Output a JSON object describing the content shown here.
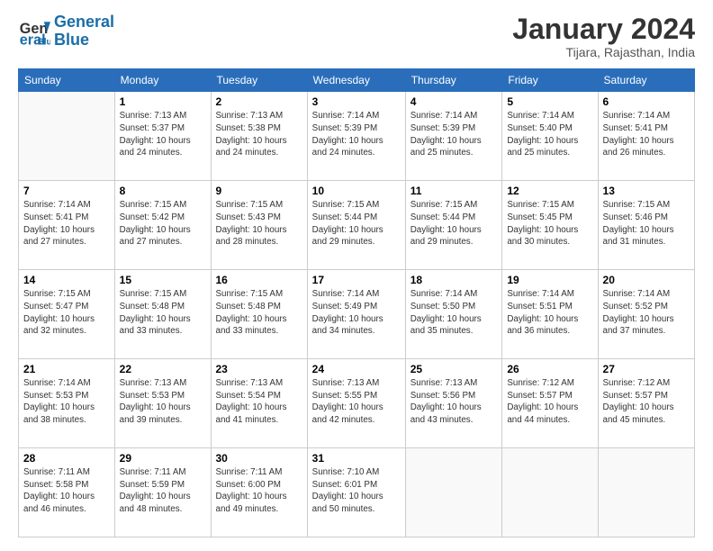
{
  "header": {
    "logo_line1": "General",
    "logo_line2": "Blue",
    "title": "January 2024",
    "location": "Tijara, Rajasthan, India"
  },
  "days_of_week": [
    "Sunday",
    "Monday",
    "Tuesday",
    "Wednesday",
    "Thursday",
    "Friday",
    "Saturday"
  ],
  "weeks": [
    [
      {
        "day": "",
        "info": ""
      },
      {
        "day": "1",
        "info": "Sunrise: 7:13 AM\nSunset: 5:37 PM\nDaylight: 10 hours\nand 24 minutes."
      },
      {
        "day": "2",
        "info": "Sunrise: 7:13 AM\nSunset: 5:38 PM\nDaylight: 10 hours\nand 24 minutes."
      },
      {
        "day": "3",
        "info": "Sunrise: 7:14 AM\nSunset: 5:39 PM\nDaylight: 10 hours\nand 24 minutes."
      },
      {
        "day": "4",
        "info": "Sunrise: 7:14 AM\nSunset: 5:39 PM\nDaylight: 10 hours\nand 25 minutes."
      },
      {
        "day": "5",
        "info": "Sunrise: 7:14 AM\nSunset: 5:40 PM\nDaylight: 10 hours\nand 25 minutes."
      },
      {
        "day": "6",
        "info": "Sunrise: 7:14 AM\nSunset: 5:41 PM\nDaylight: 10 hours\nand 26 minutes."
      }
    ],
    [
      {
        "day": "7",
        "info": "Sunrise: 7:14 AM\nSunset: 5:41 PM\nDaylight: 10 hours\nand 27 minutes."
      },
      {
        "day": "8",
        "info": "Sunrise: 7:15 AM\nSunset: 5:42 PM\nDaylight: 10 hours\nand 27 minutes."
      },
      {
        "day": "9",
        "info": "Sunrise: 7:15 AM\nSunset: 5:43 PM\nDaylight: 10 hours\nand 28 minutes."
      },
      {
        "day": "10",
        "info": "Sunrise: 7:15 AM\nSunset: 5:44 PM\nDaylight: 10 hours\nand 29 minutes."
      },
      {
        "day": "11",
        "info": "Sunrise: 7:15 AM\nSunset: 5:44 PM\nDaylight: 10 hours\nand 29 minutes."
      },
      {
        "day": "12",
        "info": "Sunrise: 7:15 AM\nSunset: 5:45 PM\nDaylight: 10 hours\nand 30 minutes."
      },
      {
        "day": "13",
        "info": "Sunrise: 7:15 AM\nSunset: 5:46 PM\nDaylight: 10 hours\nand 31 minutes."
      }
    ],
    [
      {
        "day": "14",
        "info": "Sunrise: 7:15 AM\nSunset: 5:47 PM\nDaylight: 10 hours\nand 32 minutes."
      },
      {
        "day": "15",
        "info": "Sunrise: 7:15 AM\nSunset: 5:48 PM\nDaylight: 10 hours\nand 33 minutes."
      },
      {
        "day": "16",
        "info": "Sunrise: 7:15 AM\nSunset: 5:48 PM\nDaylight: 10 hours\nand 33 minutes."
      },
      {
        "day": "17",
        "info": "Sunrise: 7:14 AM\nSunset: 5:49 PM\nDaylight: 10 hours\nand 34 minutes."
      },
      {
        "day": "18",
        "info": "Sunrise: 7:14 AM\nSunset: 5:50 PM\nDaylight: 10 hours\nand 35 minutes."
      },
      {
        "day": "19",
        "info": "Sunrise: 7:14 AM\nSunset: 5:51 PM\nDaylight: 10 hours\nand 36 minutes."
      },
      {
        "day": "20",
        "info": "Sunrise: 7:14 AM\nSunset: 5:52 PM\nDaylight: 10 hours\nand 37 minutes."
      }
    ],
    [
      {
        "day": "21",
        "info": "Sunrise: 7:14 AM\nSunset: 5:53 PM\nDaylight: 10 hours\nand 38 minutes."
      },
      {
        "day": "22",
        "info": "Sunrise: 7:13 AM\nSunset: 5:53 PM\nDaylight: 10 hours\nand 39 minutes."
      },
      {
        "day": "23",
        "info": "Sunrise: 7:13 AM\nSunset: 5:54 PM\nDaylight: 10 hours\nand 41 minutes."
      },
      {
        "day": "24",
        "info": "Sunrise: 7:13 AM\nSunset: 5:55 PM\nDaylight: 10 hours\nand 42 minutes."
      },
      {
        "day": "25",
        "info": "Sunrise: 7:13 AM\nSunset: 5:56 PM\nDaylight: 10 hours\nand 43 minutes."
      },
      {
        "day": "26",
        "info": "Sunrise: 7:12 AM\nSunset: 5:57 PM\nDaylight: 10 hours\nand 44 minutes."
      },
      {
        "day": "27",
        "info": "Sunrise: 7:12 AM\nSunset: 5:57 PM\nDaylight: 10 hours\nand 45 minutes."
      }
    ],
    [
      {
        "day": "28",
        "info": "Sunrise: 7:11 AM\nSunset: 5:58 PM\nDaylight: 10 hours\nand 46 minutes."
      },
      {
        "day": "29",
        "info": "Sunrise: 7:11 AM\nSunset: 5:59 PM\nDaylight: 10 hours\nand 48 minutes."
      },
      {
        "day": "30",
        "info": "Sunrise: 7:11 AM\nSunset: 6:00 PM\nDaylight: 10 hours\nand 49 minutes."
      },
      {
        "day": "31",
        "info": "Sunrise: 7:10 AM\nSunset: 6:01 PM\nDaylight: 10 hours\nand 50 minutes."
      },
      {
        "day": "",
        "info": ""
      },
      {
        "day": "",
        "info": ""
      },
      {
        "day": "",
        "info": ""
      }
    ]
  ]
}
